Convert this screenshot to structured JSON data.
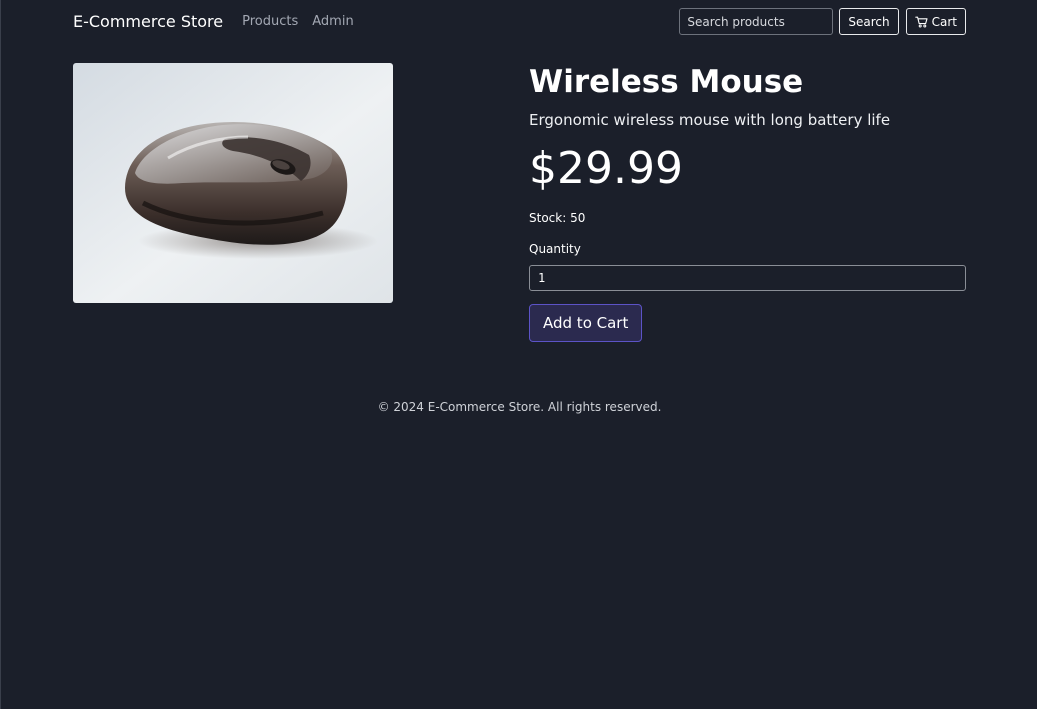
{
  "navbar": {
    "brand": "E-Commerce Store",
    "links": [
      "Products",
      "Admin"
    ],
    "search": {
      "placeholder": "Search products",
      "value": ""
    },
    "search_button": "Search",
    "cart_button": "Cart",
    "cart_icon": "shopping-cart-icon"
  },
  "product": {
    "image_subject": "computer mouse",
    "name": "Wireless Mouse",
    "description": "Ergonomic wireless mouse with long battery life",
    "price": "$29.99",
    "stock": "Stock: 50",
    "quantity_label": "Quantity",
    "quantity_value": "1",
    "add_button": "Add to Cart"
  },
  "footer": {
    "text": "© 2024 E-Commerce Store. All rights reserved."
  },
  "colors": {
    "background": "#1b1f2a",
    "accent": "#5c53c7",
    "accent_fill": "#2b2a4f"
  }
}
